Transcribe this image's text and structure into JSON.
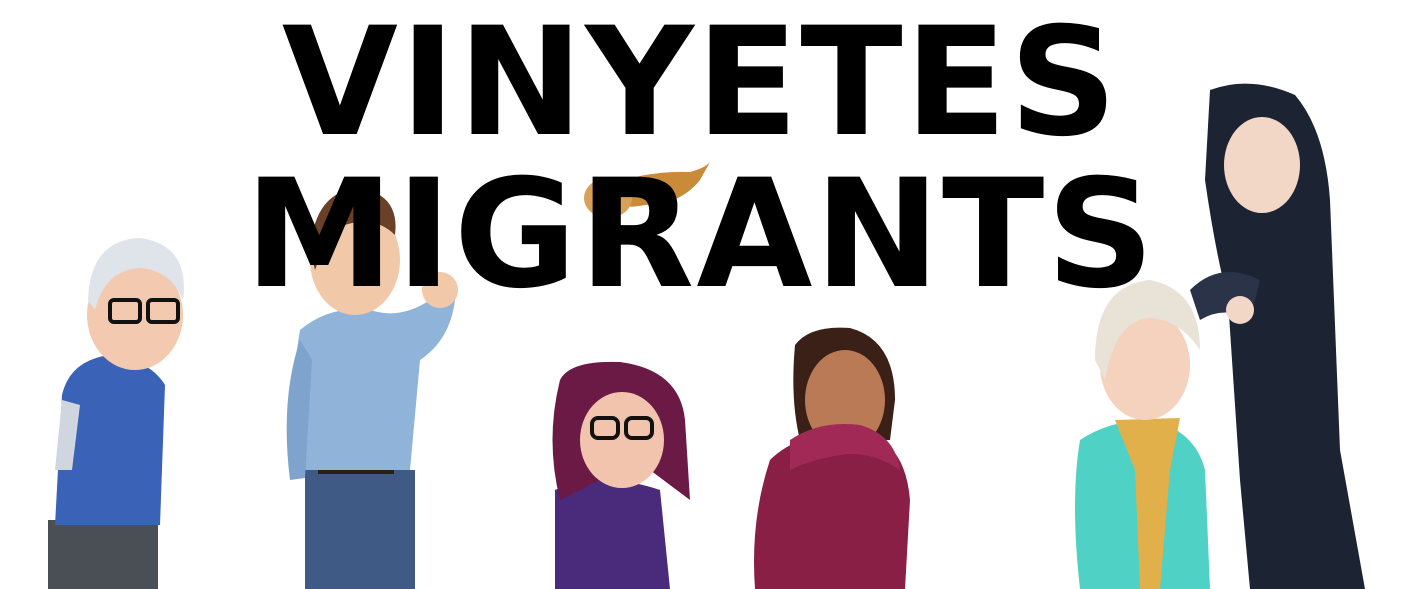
{
  "banner": {
    "title_line1": "VINYETES",
    "title_line2": "MIGRANTS"
  },
  "characters": [
    {
      "name": "elderly-man-with-glasses",
      "color": "#3a63b8"
    },
    {
      "name": "young-man-in-blue-sweater",
      "color": "#8fb3d9"
    },
    {
      "name": "curly-haired-girl-with-glasses",
      "color": "#4a2a7a"
    },
    {
      "name": "girl-in-red-puffer-jacket",
      "color": "#8a1f45"
    },
    {
      "name": "blonde-child-with-scarf",
      "color": "#4fd1c5"
    },
    {
      "name": "woman-in-hijab",
      "color": "#1c2333"
    },
    {
      "name": "small-dog",
      "color": "#c98a3a"
    }
  ]
}
